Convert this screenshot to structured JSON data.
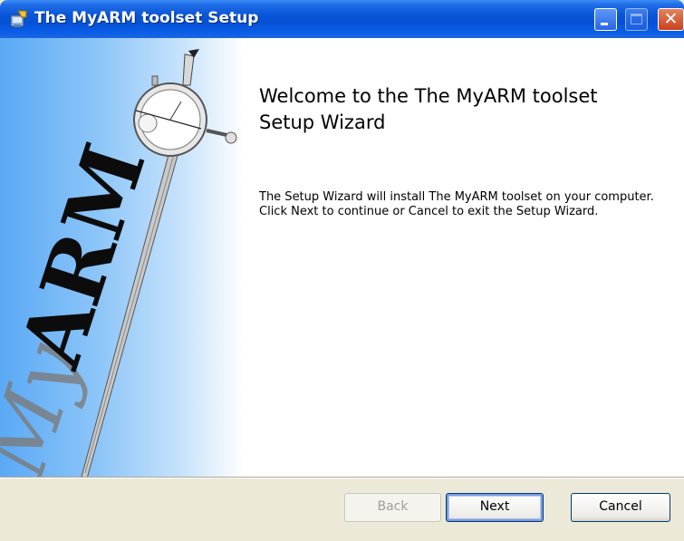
{
  "window": {
    "title": "The MyARM toolset Setup",
    "icon": "installer-icon",
    "controls": {
      "minimize": "minimize-icon",
      "maximize": "maximize-icon",
      "close": "close-icon"
    }
  },
  "banner": {
    "logo_text": "MyARM",
    "graphic": "dial-gauge-sword"
  },
  "main": {
    "title": "Welcome to the The MyARM toolset Setup Wizard",
    "body": "The Setup Wizard will install The MyARM toolset on your computer. Click Next to continue or Cancel to exit the Setup Wizard."
  },
  "buttons": {
    "back": "Back",
    "next": "Next",
    "cancel": "Cancel"
  },
  "colors": {
    "titlebar": "#0a55d8",
    "banner_blue": "#5aa9f5",
    "dialog_bg": "#ece9d8"
  }
}
